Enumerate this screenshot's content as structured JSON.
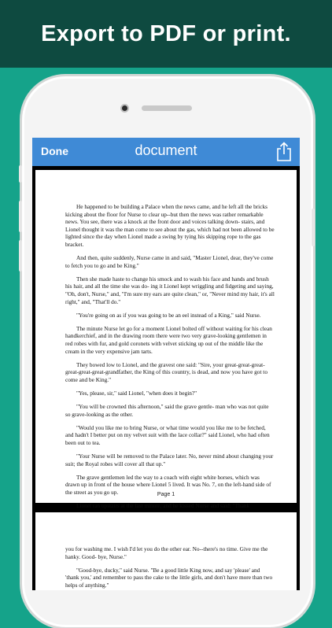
{
  "banner": {
    "text": "Export to PDF or print."
  },
  "navbar": {
    "done_label": "Done",
    "title": "document",
    "share_icon": "share-icon"
  },
  "colors": {
    "banner": "#0e4a40",
    "background": "#15a38a",
    "navbar": "#3f8ad6"
  },
  "page1": {
    "paragraphs": [
      "He happened to be building a Palace when the news came, and he left all the bricks kicking about the floor for Nurse to clear up--but then the news was rather remarkable news. You see, there was a knock at the front door and voices talking down- stairs, and Lionel thought it was the man come to see about the gas, which had not been allowed to be lighted since the day when Lionel made a swing by tying his skipping rope to the gas bracket.",
      "And then, quite suddenly, Nurse came in and said, \"Master Lionel, dear, they've come to fetch you to go and be King.\"",
      "Then she made haste to change his smock and to wash his face and hands and brush his hair, and all the time she was do- ing it Lionel kept wriggling and fidgeting and saying, \"Oh, don't, Nurse,\" and, \"I'm sure my ears are quite clean,\" or, \"Never mind my hair, it's all right,\" and, \"That'll do.\"",
      "\"You're going on as if you was going to be an eel instead of a King,\" said Nurse.",
      "The minute Nurse let go for a moment Lionel bolted off without waiting for his clean handkerchief, and in the drawing room there were two very grave-looking gentlemen in red robes with fur, and gold coronets with velvet sticking up out of the middle like the cream in the very expensive jam tarts.",
      "They bowed low to Lionel, and the gravest one said: \"Sire, your great-great-great-great-great-great-grandfather, the King of this country, is dead, and now you have got to come and be King.\"",
      "\"Yes, please, sir,\" said Lionel, \"when does it begin?\"",
      "\"You will be crowned this afternoon,\" said the grave gentle- man who was not quite so grave-looking as the other.",
      "\"Would you like me to bring Nurse, or what time would you like me to be fetched, and hadn't I better put on my velvet suit with the lace collar?\" said Lionel, who had often been out to tea.",
      "\"Your Nurse will be removed to the Palace later. No, never mind about changing your suit; the Royal robes will cover all that up.\"",
      "The grave gentlemen led the way to a coach with eight white horses, which was drawn up in front of the house where Lionel 5 lived. It was No. 7, on the left-hand side of the street as you go up.",
      "Lionel ran upstairs at the last minute, and he kissed Nurse and said: \"Thank"
    ],
    "page_label": "Page 1"
  },
  "page2": {
    "paragraphs": [
      "you for washing me. I wish I'd let you do the other ear. No--there's no time. Give me the hanky. Good- bye, Nurse.\"",
      "\"Good-bye, ducky,\" said Nurse. \"Be a good little King now, and say 'please' and 'thank you,' and remember to pass the cake to the little girls, and don't have more than two helps of anything.\""
    ]
  }
}
